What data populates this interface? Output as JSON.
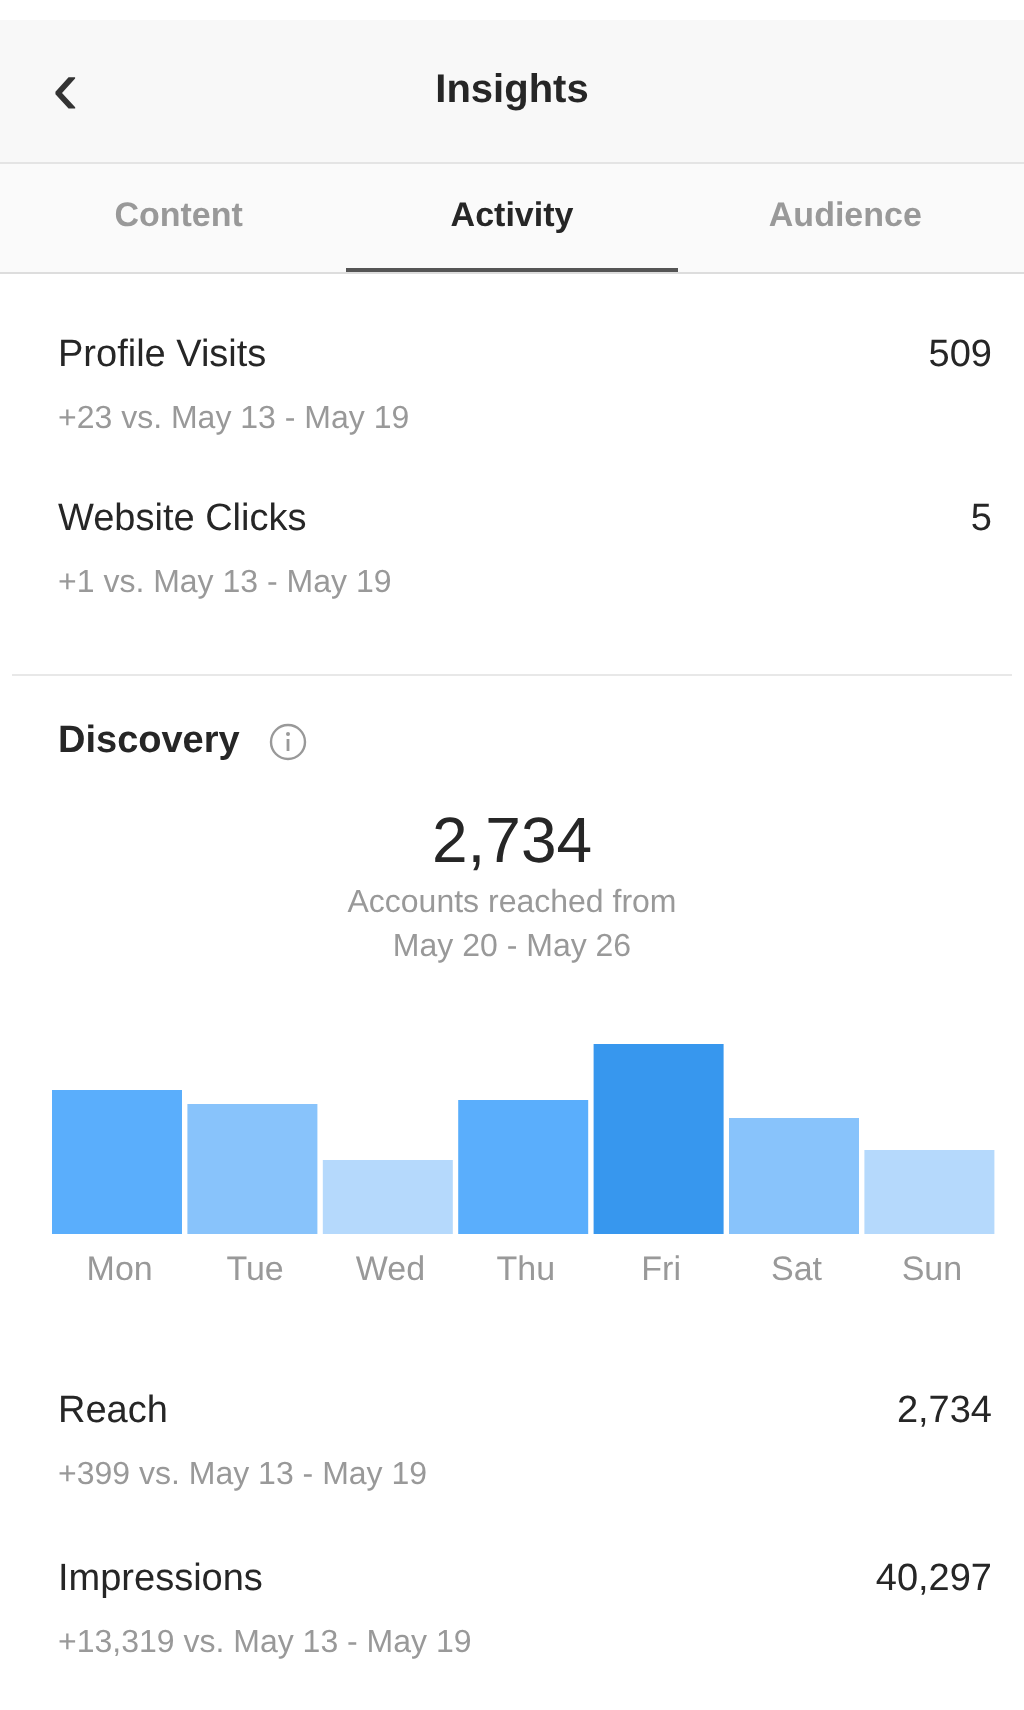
{
  "header": {
    "back": "‹",
    "title": "Insights"
  },
  "tabs": [
    {
      "label": "Content",
      "selected": false
    },
    {
      "label": "Activity",
      "selected": true
    },
    {
      "label": "Audience",
      "selected": false
    }
  ],
  "interactions": [
    {
      "label": "Profile Visits",
      "value": "509",
      "comparison": "+23 vs. May 13 - May 19"
    },
    {
      "label": "Website Clicks",
      "value": "5",
      "comparison": "+1 vs. May 13 - May 19"
    }
  ],
  "discovery": {
    "title": "Discovery",
    "total": "2,734",
    "caption_line_1": "Accounts reached from",
    "caption_line_2": "May 20 - May 26",
    "days": [
      "Mon",
      "Tue",
      "Wed",
      "Thu",
      "Fri",
      "Sat",
      "Sun"
    ],
    "metrics": [
      {
        "label": "Reach",
        "value": "2,734",
        "comparison": "+399 vs. May 13 - May 19"
      },
      {
        "label": "Impressions",
        "value": "40,297",
        "comparison": "+13,319 vs. May 13 - May 19"
      }
    ]
  }
}
